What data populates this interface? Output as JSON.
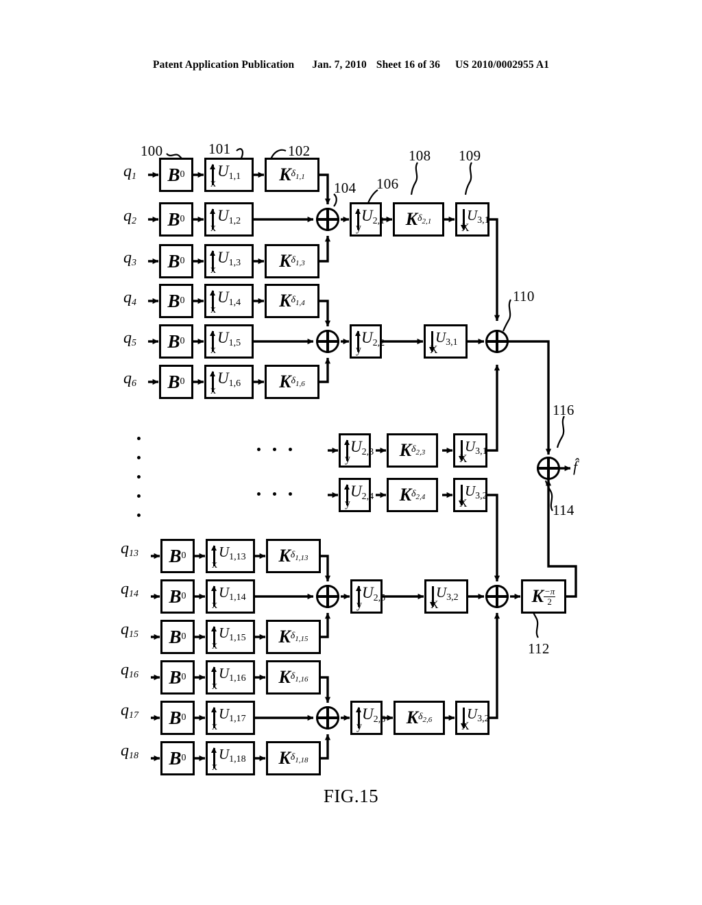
{
  "header": {
    "publication": "Patent Application Publication",
    "date": "Jan. 7, 2010",
    "sheet": "Sheet 16 of 36",
    "docnum": "US 2010/0002955 A1"
  },
  "figure": {
    "caption": "FIG.15",
    "output_label": "f̂"
  },
  "inputs": [
    {
      "id": "q1",
      "label": "q",
      "sub": "1"
    },
    {
      "id": "q2",
      "label": "q",
      "sub": "2"
    },
    {
      "id": "q3",
      "label": "q",
      "sub": "3"
    },
    {
      "id": "q4",
      "label": "q",
      "sub": "4"
    },
    {
      "id": "q5",
      "label": "q",
      "sub": "5"
    },
    {
      "id": "q6",
      "label": "q",
      "sub": "6"
    },
    {
      "id": "q13",
      "label": "q",
      "sub": "13"
    },
    {
      "id": "q14",
      "label": "q",
      "sub": "14"
    },
    {
      "id": "q15",
      "label": "q",
      "sub": "15"
    },
    {
      "id": "q16",
      "label": "q",
      "sub": "16"
    },
    {
      "id": "q17",
      "label": "q",
      "sub": "17"
    },
    {
      "id": "q18",
      "label": "q",
      "sub": "18"
    }
  ],
  "blocks": {
    "beamformer": {
      "symbol": "B",
      "sub": "0"
    },
    "stage1_u": [
      {
        "sym": "U",
        "sub": "1,1",
        "axis": "x",
        "dir": "up"
      },
      {
        "sym": "U",
        "sub": "1,2",
        "axis": "x",
        "dir": "up"
      },
      {
        "sym": "U",
        "sub": "1,3",
        "axis": "x",
        "dir": "up"
      },
      {
        "sym": "U",
        "sub": "1,4",
        "axis": "x",
        "dir": "up"
      },
      {
        "sym": "U",
        "sub": "1,5",
        "axis": "x",
        "dir": "up"
      },
      {
        "sym": "U",
        "sub": "1,6",
        "axis": "x",
        "dir": "up"
      },
      {
        "sym": "U",
        "sub": "1,13",
        "axis": "x",
        "dir": "up"
      },
      {
        "sym": "U",
        "sub": "1,14",
        "axis": "x",
        "dir": "up"
      },
      {
        "sym": "U",
        "sub": "1,15",
        "axis": "x",
        "dir": "up"
      },
      {
        "sym": "U",
        "sub": "1,16",
        "axis": "x",
        "dir": "up"
      },
      {
        "sym": "U",
        "sub": "1,17",
        "axis": "x",
        "dir": "up"
      },
      {
        "sym": "U",
        "sub": "1,18",
        "axis": "x",
        "dir": "up"
      }
    ],
    "stage1_k": [
      {
        "sym": "K",
        "sub": "δ",
        "sub2": "1,1"
      },
      {
        "sym": "K",
        "sub": "δ",
        "sub2": "1,3"
      },
      {
        "sym": "K",
        "sub": "δ",
        "sub2": "1,4"
      },
      {
        "sym": "K",
        "sub": "δ",
        "sub2": "1,6"
      },
      {
        "sym": "K",
        "sub": "δ",
        "sub2": "1,13"
      },
      {
        "sym": "K",
        "sub": "δ",
        "sub2": "1,15"
      },
      {
        "sym": "K",
        "sub": "δ",
        "sub2": "1,16"
      },
      {
        "sym": "K",
        "sub": "δ",
        "sub2": "1,18"
      }
    ],
    "stage2_u": [
      {
        "sym": "U",
        "sub": "2,1",
        "axis": "y",
        "dir": "up"
      },
      {
        "sym": "U",
        "sub": "2,2",
        "axis": "y",
        "dir": "up"
      },
      {
        "sym": "U",
        "sub": "2,3",
        "axis": "y",
        "dir": "up"
      },
      {
        "sym": "U",
        "sub": "2,4",
        "axis": "y",
        "dir": "up"
      },
      {
        "sym": "U",
        "sub": "2,5",
        "axis": "y",
        "dir": "up"
      },
      {
        "sym": "U",
        "sub": "2,6",
        "axis": "y",
        "dir": "up"
      }
    ],
    "stage2_k": [
      {
        "sym": "K",
        "sub": "δ",
        "sub2": "2,1"
      },
      {
        "sym": "K",
        "sub": "δ",
        "sub2": "2,3"
      },
      {
        "sym": "K",
        "sub": "δ",
        "sub2": "2,4"
      },
      {
        "sym": "K",
        "sub": "δ",
        "sub2": "2,6"
      }
    ],
    "stage3_u": [
      {
        "sym": "U",
        "sub": "3,1",
        "axis": "x",
        "dir": "down"
      },
      {
        "sym": "U",
        "sub": "3,1",
        "axis": "x",
        "dir": "down"
      },
      {
        "sym": "U",
        "sub": "3,1",
        "axis": "x",
        "dir": "down"
      },
      {
        "sym": "U",
        "sub": "3,2",
        "axis": "x",
        "dir": "down"
      },
      {
        "sym": "U",
        "sub": "3,2",
        "axis": "x",
        "dir": "down"
      },
      {
        "sym": "U",
        "sub": "3,2",
        "axis": "x",
        "dir": "down"
      }
    ],
    "phase_shift": {
      "sym": "K",
      "num": "−π",
      "den": "2"
    }
  },
  "reference_numerals": [
    {
      "id": "100",
      "text": "100"
    },
    {
      "id": "101",
      "text": "101"
    },
    {
      "id": "102",
      "text": "102"
    },
    {
      "id": "104",
      "text": "104"
    },
    {
      "id": "106",
      "text": "106"
    },
    {
      "id": "108",
      "text": "108"
    },
    {
      "id": "109",
      "text": "109"
    },
    {
      "id": "110",
      "text": "110"
    },
    {
      "id": "112",
      "text": "112"
    },
    {
      "id": "114",
      "text": "114"
    },
    {
      "id": "116",
      "text": "116"
    }
  ],
  "ellipsis": {
    "vertical_dots": 5,
    "horizontal_dots": 3
  }
}
